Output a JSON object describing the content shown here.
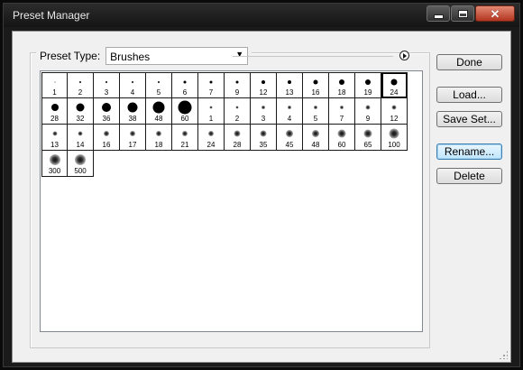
{
  "window": {
    "title": "Preset Manager",
    "controls": [
      "minimize-icon",
      "maximize-icon",
      "close-icon"
    ]
  },
  "preset_type": {
    "label": "Preset Type:",
    "value": "Brushes"
  },
  "brushes": [
    {
      "size": "1",
      "style": "hard"
    },
    {
      "size": "2",
      "style": "hard"
    },
    {
      "size": "3",
      "style": "hard"
    },
    {
      "size": "4",
      "style": "hard"
    },
    {
      "size": "5",
      "style": "hard"
    },
    {
      "size": "6",
      "style": "hard"
    },
    {
      "size": "7",
      "style": "hard"
    },
    {
      "size": "9",
      "style": "hard"
    },
    {
      "size": "12",
      "style": "hard"
    },
    {
      "size": "13",
      "style": "hard"
    },
    {
      "size": "16",
      "style": "hard"
    },
    {
      "size": "18",
      "style": "hard"
    },
    {
      "size": "19",
      "style": "hard"
    },
    {
      "size": "24",
      "style": "hard",
      "selected": true
    },
    {
      "size": "28",
      "style": "hard"
    },
    {
      "size": "32",
      "style": "hard"
    },
    {
      "size": "36",
      "style": "hard"
    },
    {
      "size": "38",
      "style": "hard"
    },
    {
      "size": "48",
      "style": "hard"
    },
    {
      "size": "60",
      "style": "hard"
    },
    {
      "size": "1",
      "style": "soft"
    },
    {
      "size": "2",
      "style": "soft"
    },
    {
      "size": "3",
      "style": "soft"
    },
    {
      "size": "4",
      "style": "soft"
    },
    {
      "size": "5",
      "style": "soft"
    },
    {
      "size": "7",
      "style": "soft"
    },
    {
      "size": "9",
      "style": "soft"
    },
    {
      "size": "12",
      "style": "soft"
    },
    {
      "size": "13",
      "style": "soft"
    },
    {
      "size": "14",
      "style": "soft"
    },
    {
      "size": "16",
      "style": "soft"
    },
    {
      "size": "17",
      "style": "soft"
    },
    {
      "size": "18",
      "style": "soft"
    },
    {
      "size": "21",
      "style": "soft"
    },
    {
      "size": "24",
      "style": "soft"
    },
    {
      "size": "28",
      "style": "soft"
    },
    {
      "size": "35",
      "style": "soft"
    },
    {
      "size": "45",
      "style": "soft"
    },
    {
      "size": "48",
      "style": "soft"
    },
    {
      "size": "60",
      "style": "soft"
    },
    {
      "size": "65",
      "style": "soft"
    },
    {
      "size": "100",
      "style": "soft"
    },
    {
      "size": "300",
      "style": "soft"
    },
    {
      "size": "500",
      "style": "soft"
    }
  ],
  "buttons": {
    "done": "Done",
    "load": "Load...",
    "save_set": "Save Set...",
    "rename": "Rename...",
    "delete": "Delete"
  }
}
